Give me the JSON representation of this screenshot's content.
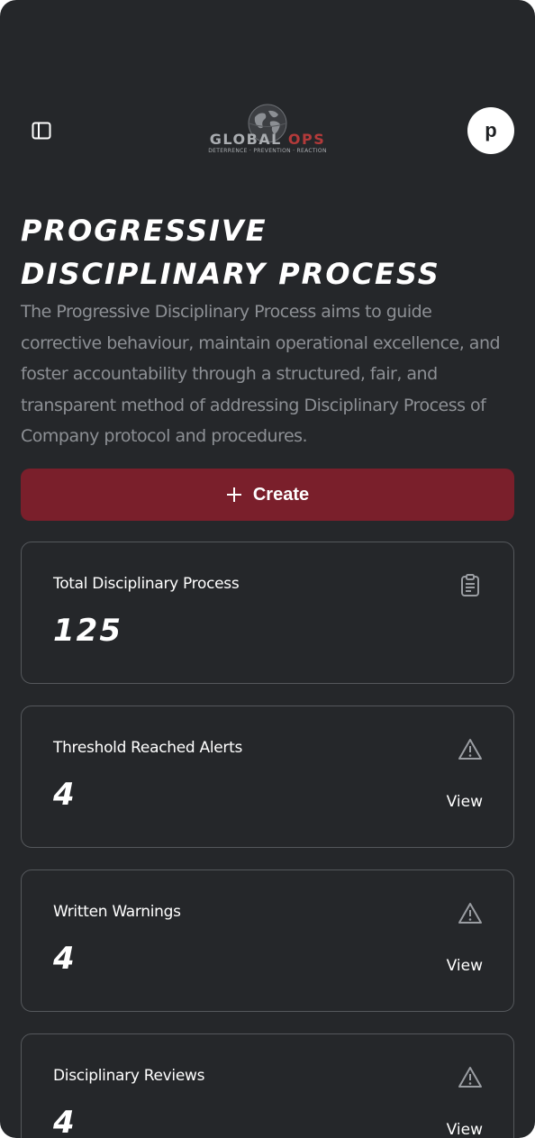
{
  "header": {
    "logo_word_a": "GLOBAL ",
    "logo_word_b": "OPS",
    "logo_tagline": "DETERRENCE · PREVENTION · REACTION",
    "avatar_initial": "p"
  },
  "page": {
    "title": "Progressive Disciplinary Process",
    "description": "The Progressive Disciplinary Process aims to guide corrective behaviour, maintain operational excellence, and foster accountability through a structured, fair, and transparent method of addressing Disciplinary Process of Company protocol and procedures.",
    "create_label": "Create"
  },
  "stats": {
    "total": {
      "label": "Total Disciplinary Process",
      "value": "125",
      "icon": "clipboard-icon"
    },
    "threshold": {
      "label": "Threshold Reached Alerts",
      "value": "4",
      "link": "View",
      "icon": "warning-icon"
    },
    "warnings": {
      "label": "Written Warnings",
      "value": "4",
      "link": "View",
      "icon": "warning-icon"
    },
    "reviews": {
      "label": "Disciplinary Reviews",
      "value": "4",
      "link": "View",
      "icon": "warning-icon"
    }
  },
  "colors": {
    "background": "#25272a",
    "accent": "#7a1f2b",
    "text_muted": "#8d9095",
    "border": "#55585c"
  }
}
